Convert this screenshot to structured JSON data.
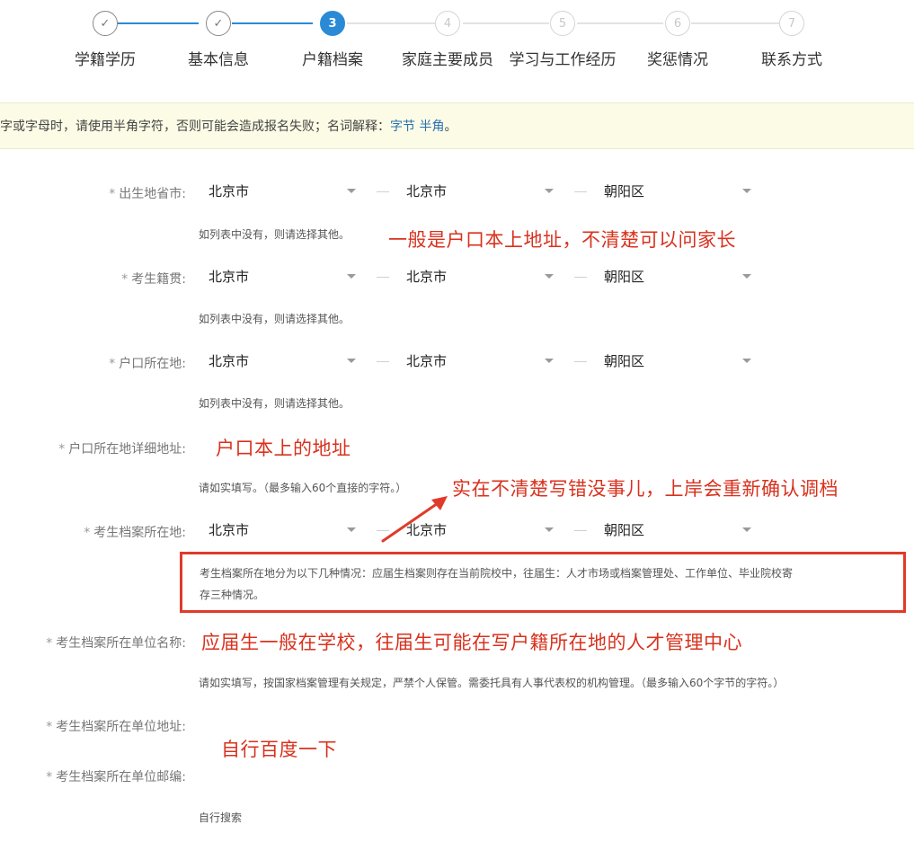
{
  "steps": [
    {
      "num": "✓",
      "label": "学籍学历"
    },
    {
      "num": "✓",
      "label": "基本信息"
    },
    {
      "num": "3",
      "label": "户籍档案"
    },
    {
      "num": "4",
      "label": "家庭主要成员"
    },
    {
      "num": "5",
      "label": "学习与工作经历"
    },
    {
      "num": "6",
      "label": "奖惩情况"
    },
    {
      "num": "7",
      "label": "联系方式"
    }
  ],
  "notice": {
    "text": "字或字母时，请使用半角字符，否则可能会造成报名失败；名词解释：",
    "link1": "字节",
    "link2": "半角",
    "tail": "。"
  },
  "form": {
    "required_mark": "*",
    "birth": {
      "label": "出生地省市:",
      "province": "北京市",
      "city": "北京市",
      "district": "朝阳区",
      "hint": "如列表中没有，则请选择其他。"
    },
    "native": {
      "label": "考生籍贯:",
      "province": "北京市",
      "city": "北京市",
      "district": "朝阳区",
      "hint": "如列表中没有，则请选择其他。"
    },
    "hukou": {
      "label": "户口所在地:",
      "province": "北京市",
      "city": "北京市",
      "district": "朝阳区",
      "hint": "如列表中没有，则请选择其他。"
    },
    "hukou_detail": {
      "label": "户口所在地详细地址:",
      "hint": "请如实填写。（最多输入60个直接的字符。）"
    },
    "archive": {
      "label": "考生档案所在地:",
      "province": "北京市",
      "city": "北京市",
      "district": "朝阳区",
      "hint_line1": "考生档案所在地分为以下几种情况：应届生档案则存在当前院校中，往届生：人才市场或档案管理处、工作单位、毕业院校寄",
      "hint_line2": "存三种情况。"
    },
    "archive_unit": {
      "label": "考生档案所在单位名称:",
      "hint": "请如实填写，按国家档案管理有关规定，严禁个人保管。需委托具有人事代表权的机构管理。（最多输入60个字节的字符。）"
    },
    "archive_address": {
      "label": "考生档案所在单位地址:"
    },
    "archive_zip": {
      "label": "考生档案所在单位邮编:",
      "hint": "自行搜索"
    }
  },
  "annotations": {
    "a1": "一般是户口本上地址，不清楚可以问家长",
    "a2": "户口本上的地址",
    "a3": "实在不清楚写错没事儿，上岸会重新确认调档",
    "a4": "应届生一般在学校，往届生可能在写户籍所在地的人才管理中心",
    "a5": "自行百度一下"
  },
  "colors": {
    "accent": "#2a8ad6",
    "annotation": "#d8321e",
    "notice_bg": "#fcfce6"
  }
}
